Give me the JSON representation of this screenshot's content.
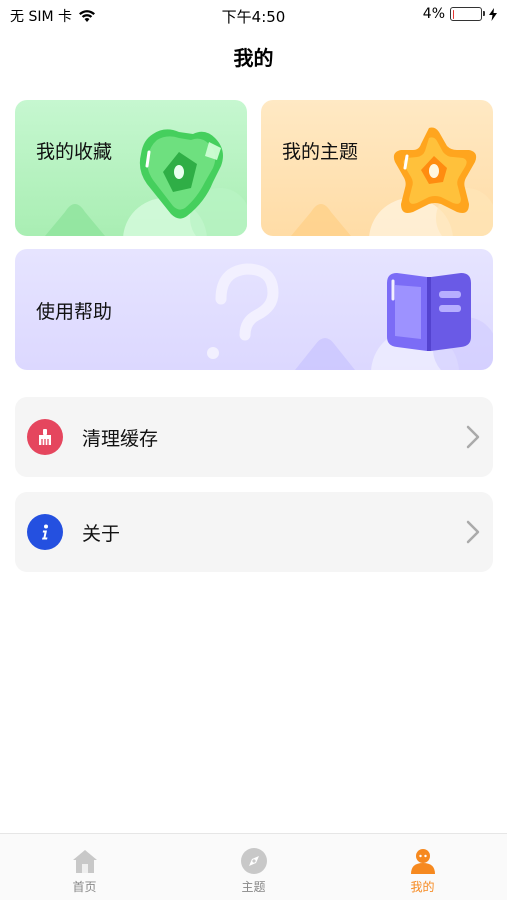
{
  "status_bar": {
    "carrier": "无 SIM 卡",
    "time": "下午4:50",
    "battery_percent": "4%",
    "battery_level": 0.04
  },
  "header": {
    "title": "我的"
  },
  "cards": {
    "favorites": {
      "label": "我的收藏",
      "color": "#4cd964"
    },
    "themes": {
      "label": "我的主题",
      "color": "#ffa51e"
    },
    "help": {
      "label": "使用帮助",
      "color": "#7b6cf6"
    }
  },
  "list": {
    "clear_cache": {
      "label": "清理缓存",
      "icon": "broom-icon",
      "icon_color": "#e5465e"
    },
    "about": {
      "label": "关于",
      "icon": "info-icon",
      "icon_color": "#2450e0"
    }
  },
  "tab_bar": {
    "tabs": [
      {
        "label": "首页",
        "icon": "home-icon",
        "active": false
      },
      {
        "label": "主题",
        "icon": "compass-icon",
        "active": false
      },
      {
        "label": "我的",
        "icon": "user-icon",
        "active": true
      }
    ],
    "active_color": "#f6891f",
    "inactive_color": "#888888"
  }
}
